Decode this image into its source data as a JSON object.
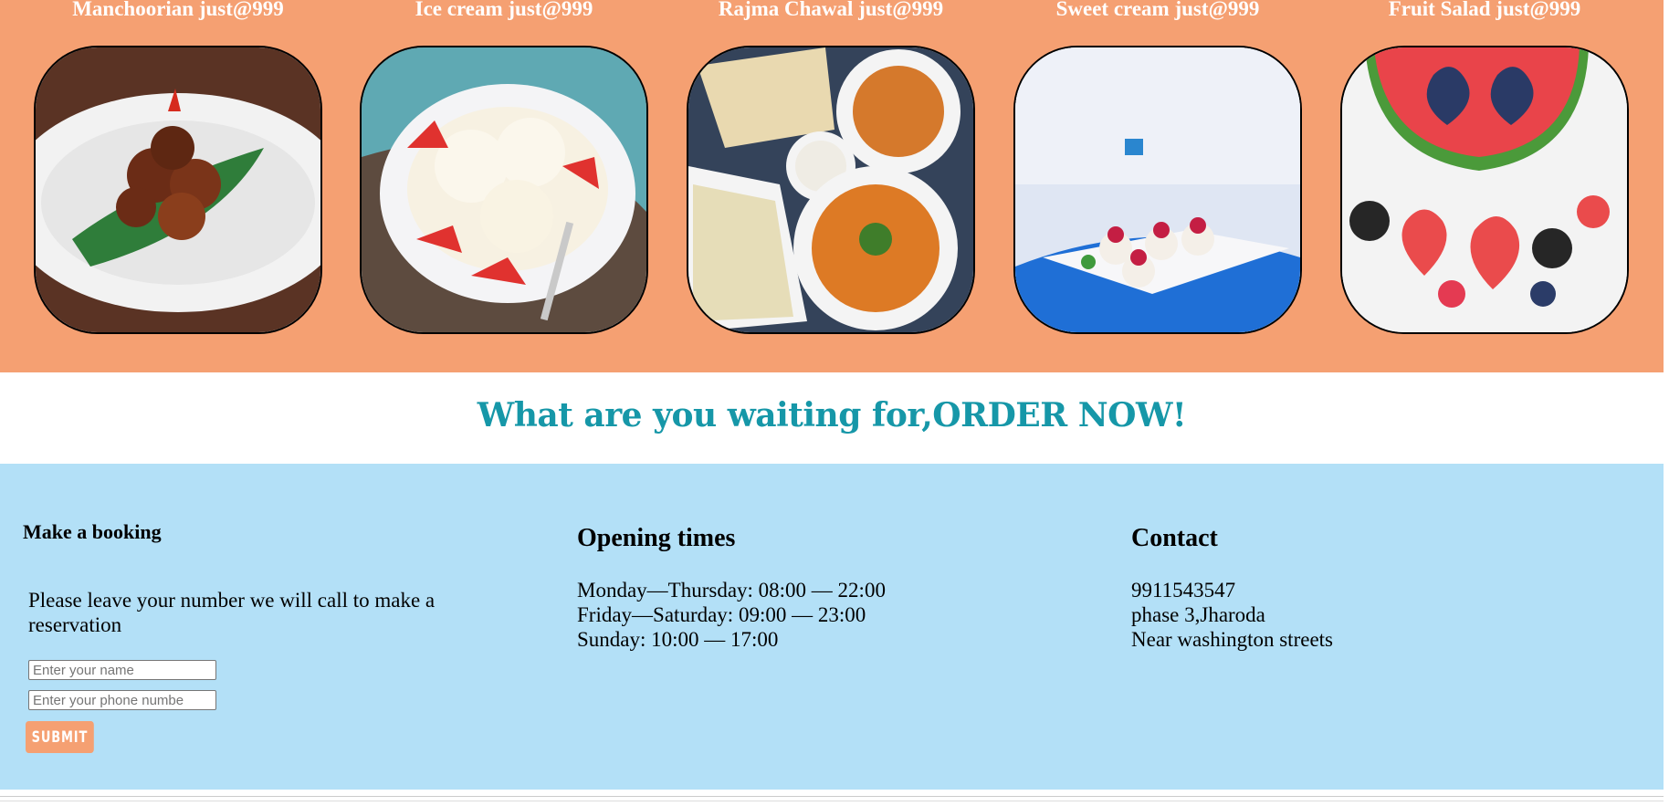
{
  "menu": {
    "items": [
      {
        "title": "Manchoorian just@999",
        "photo_icon": "manchurian-photo"
      },
      {
        "title": "Ice cream just@999",
        "photo_icon": "ice-cream-photo"
      },
      {
        "title": "Rajma Chawal just@999",
        "photo_icon": "rajma-chawal-photo"
      },
      {
        "title": "Sweet cream just@999",
        "photo_icon": "sweet-cream-photo"
      },
      {
        "title": "Fruit Salad just@999",
        "photo_icon": "fruit-salad-photo"
      }
    ]
  },
  "cta": {
    "title": "What are you waiting for,ORDER NOW!"
  },
  "booking": {
    "title": "Make a booking",
    "text": "Please leave your number we will call to make a reservation",
    "name_placeholder": "Enter your name",
    "phone_placeholder": "Enter your phone numbe",
    "submit_label": "SUBMIT"
  },
  "opening": {
    "title": "Opening times",
    "lines": [
      "Monday—Thursday: 08:00 — 22:00",
      "Friday—Saturday: 09:00 — 23:00",
      "Sunday: 10:00 — 17:00"
    ]
  },
  "contact": {
    "title": "Contact",
    "lines": [
      "9911543547",
      "phase 3,Jharoda",
      "Near washington streets"
    ]
  },
  "colors": {
    "menu_band": "#f5a072",
    "cta_text": "#1697a8",
    "footer_band": "#b3e0f7"
  }
}
